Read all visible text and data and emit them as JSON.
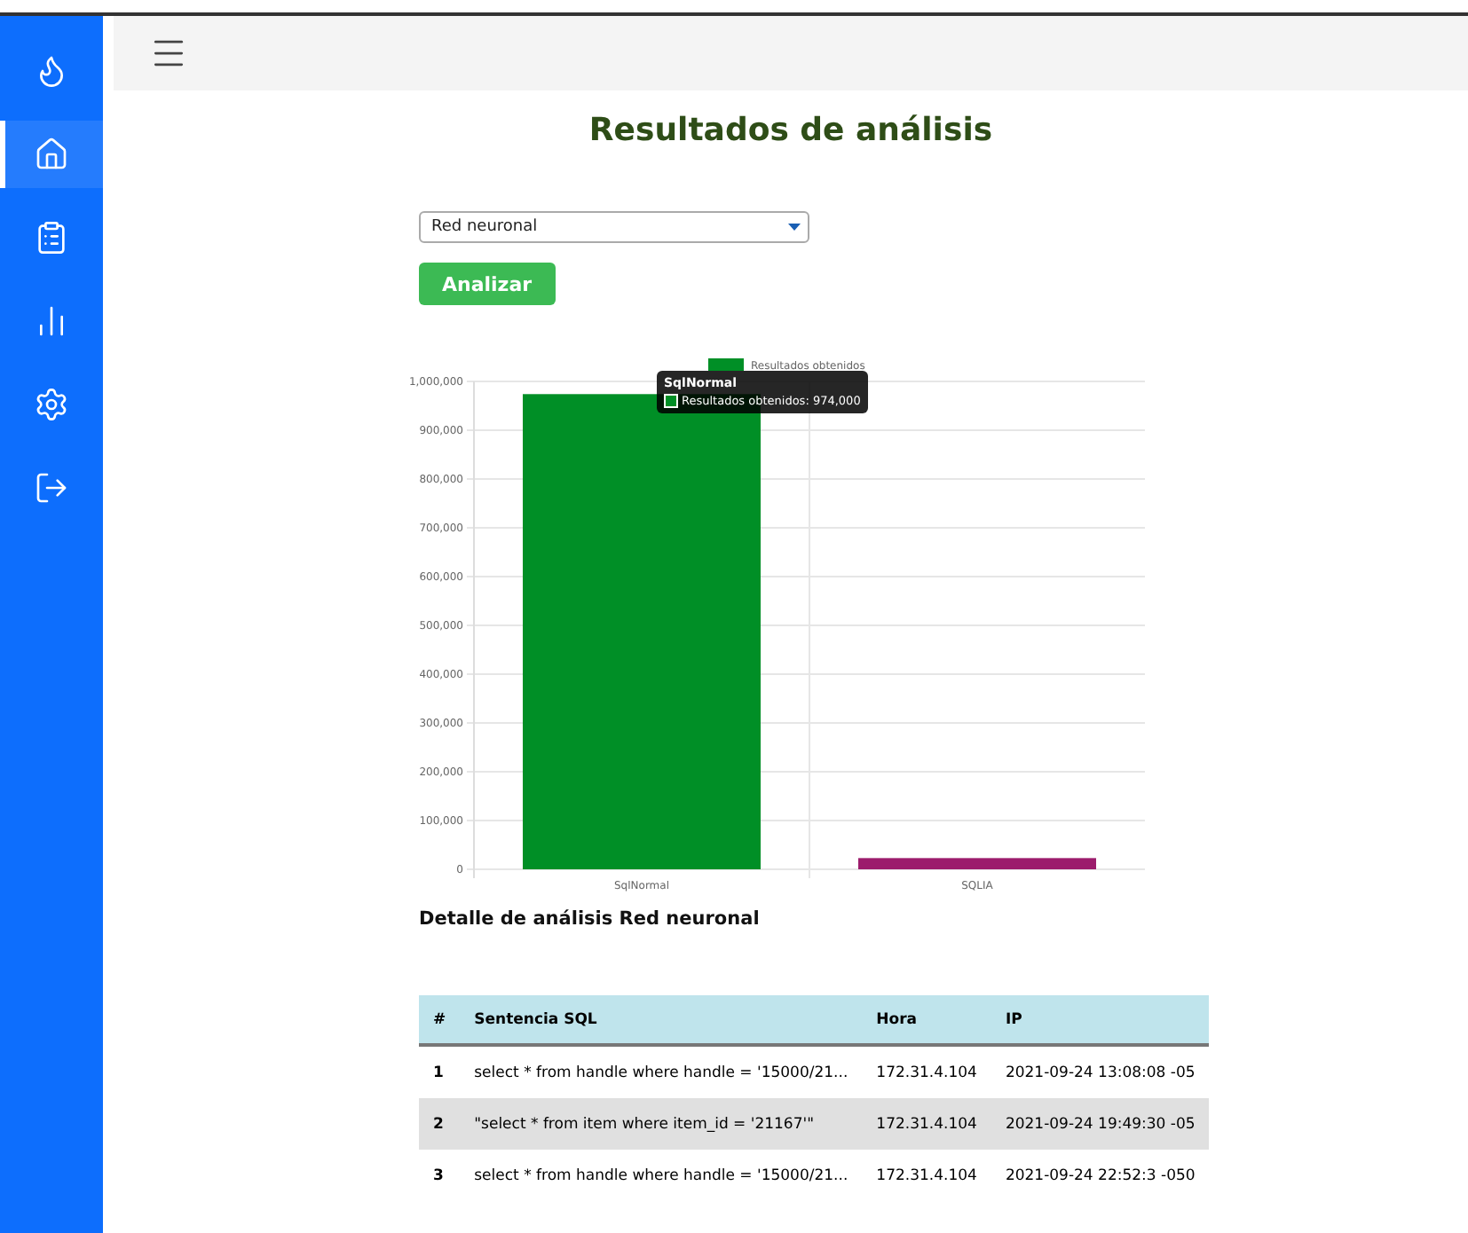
{
  "sidebar": {
    "items": [
      {
        "kind": "flame",
        "selected": false
      },
      {
        "kind": "home",
        "selected": true
      },
      {
        "kind": "report",
        "selected": false
      },
      {
        "kind": "stats",
        "selected": false
      },
      {
        "kind": "settings",
        "selected": false
      },
      {
        "kind": "logout",
        "selected": false
      }
    ]
  },
  "title": "Resultados de análisis",
  "model_select": {
    "value": "Red neuronal"
  },
  "analyze_button": "Analizar",
  "chart": {
    "chart_data": {
      "type": "bar",
      "categories": [
        "SqlNormal",
        "SQLIA"
      ],
      "series": [
        {
          "name": "Resultados obtenidos",
          "values": [
            974000,
            23000
          ]
        }
      ],
      "grid": true,
      "ylim": [
        0,
        1000000
      ],
      "yticks": [
        {
          "value": 0,
          "label": "0"
        },
        {
          "value": 100000,
          "label": "100,000"
        },
        {
          "value": 200000,
          "label": "200,000"
        },
        {
          "value": 300000,
          "label": "300,000"
        },
        {
          "value": 400000,
          "label": "400,000"
        },
        {
          "value": 500000,
          "label": "500,000"
        },
        {
          "value": 600000,
          "label": "600,000"
        },
        {
          "value": 700000,
          "label": "700,000"
        },
        {
          "value": 800000,
          "label": "800,000"
        },
        {
          "value": 900000,
          "label": "900,000"
        },
        {
          "value": 1000000,
          "label": "1,000,000"
        }
      ]
    },
    "bars": [
      {
        "color": "#008f26"
      },
      {
        "color": "#9c1c6c"
      }
    ],
    "tooltip": {
      "title": "SqlNormal",
      "label": "Resultados obtenidos: 974,000"
    }
  },
  "detail_title": "Detalle de análisis Red neuronal",
  "table": {
    "columns": [
      "#",
      "Sentencia SQL",
      "Hora",
      "IP"
    ],
    "rows": [
      {
        "cells": [
          "1",
          "select * from handle where handle = '15000/21...",
          "172.31.4.104",
          "2021-09-24 13:08:08 -05"
        ]
      },
      {
        "cells": [
          "2",
          "\"select * from item where item_id = '21167'\"",
          "172.31.4.104",
          "2021-09-24 19:49:30 -05"
        ]
      },
      {
        "cells": [
          "3",
          "select * from handle where handle = '15000/21...",
          "172.31.4.104",
          "2021-09-24 22:52:3 -050"
        ]
      }
    ]
  }
}
